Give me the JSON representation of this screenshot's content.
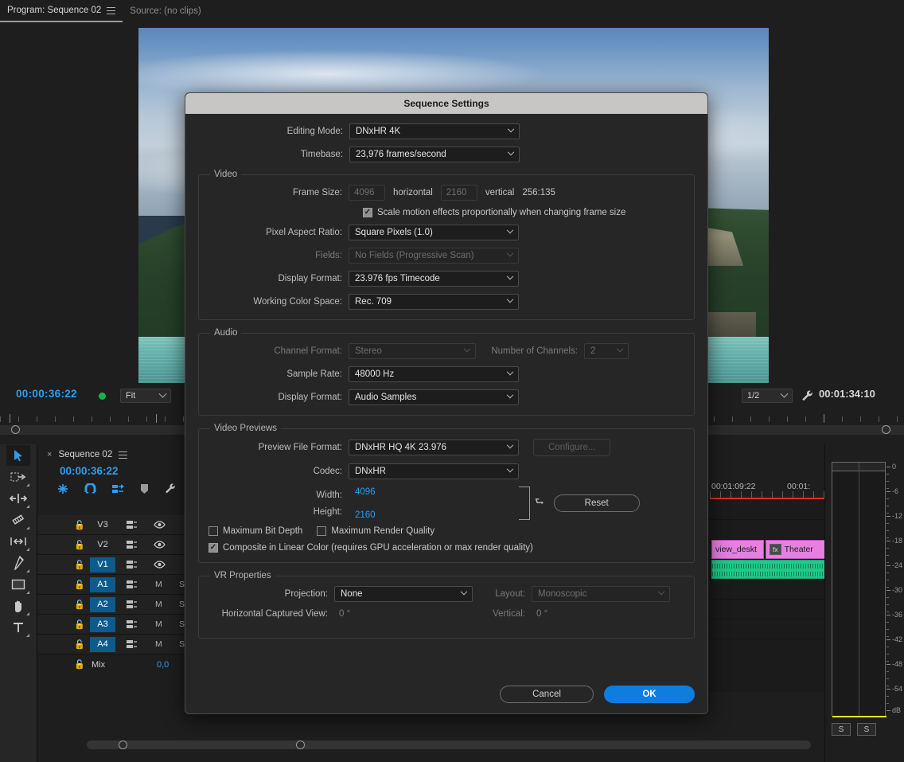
{
  "app": {
    "panel_tabs": [
      {
        "label": "Program: Sequence 02",
        "active": true,
        "menu_icon": "hamburger-menu-icon"
      },
      {
        "label": "Source: (no clips)",
        "active": false
      }
    ]
  },
  "program_monitor": {
    "current_timecode": "00:00:36:22",
    "status_dot": "green-record-dot",
    "zoom_level": "Fit",
    "playback_resolution": "1/2",
    "settings_icon": "wrench-icon",
    "duration_timecode": "00:01:34:10"
  },
  "timeline_panel": {
    "tab_label": "Sequence 02",
    "close_icon": "close-icon",
    "menu_icon": "hamburger-menu-icon",
    "playhead_timecode": "00:00:36:22",
    "toggle_icons": [
      "insert-overwrite-sequence-icon",
      "snap-magnet-icon",
      "linked-selection-icon",
      "add-marker-icon",
      "timeline-settings-wrench-icon"
    ],
    "ruler_labels": [
      "00:01:09:22",
      "00:01:"
    ],
    "tracks": [
      {
        "name": "V3",
        "type": "video",
        "targeted": false,
        "lock": "lock-icon",
        "sync": "sync-lock-icon",
        "eye": "eye-icon"
      },
      {
        "name": "V2",
        "type": "video",
        "targeted": false,
        "lock": "lock-icon",
        "sync": "sync-lock-icon",
        "eye": "eye-icon"
      },
      {
        "name": "V1",
        "type": "video",
        "targeted": true,
        "lock": "lock-icon",
        "sync": "sync-lock-icon",
        "eye": "eye-icon"
      },
      {
        "name": "A1",
        "type": "audio",
        "targeted": true,
        "lock": "lock-icon",
        "sync": "sync-lock-icon",
        "mute": "M",
        "solo": "S"
      },
      {
        "name": "A2",
        "type": "audio",
        "targeted": true,
        "lock": "lock-icon",
        "sync": "sync-lock-icon",
        "mute": "M",
        "solo": "S"
      },
      {
        "name": "A3",
        "type": "audio",
        "targeted": true,
        "lock": "lock-icon",
        "sync": "sync-lock-icon",
        "mute": "M",
        "solo": "S"
      },
      {
        "name": "A4",
        "type": "audio",
        "targeted": true,
        "lock": "lock-icon",
        "sync": "sync-lock-icon",
        "mute": "M",
        "solo": "S"
      }
    ],
    "mix_track": {
      "name": "Mix",
      "lock": "lock-icon",
      "value": "0,0"
    },
    "clips": [
      {
        "label": "view_deskt",
        "type": "video",
        "has_fx": false
      },
      {
        "label": "Theater",
        "type": "video",
        "has_fx": true,
        "fx_badge": "fx"
      }
    ],
    "add_track_button": "+"
  },
  "tools": [
    {
      "name": "selection-tool",
      "glyph": "arrow",
      "active": true
    },
    {
      "name": "track-select-forward-tool",
      "glyph": "track-select",
      "active": false
    },
    {
      "name": "ripple-edit-tool",
      "glyph": "ripple",
      "active": false
    },
    {
      "name": "razor-tool",
      "glyph": "razor",
      "active": false
    },
    {
      "name": "slip-tool",
      "glyph": "slip",
      "active": false
    },
    {
      "name": "pen-tool",
      "glyph": "pen",
      "active": false
    },
    {
      "name": "rectangle-tool",
      "glyph": "rect",
      "active": false
    },
    {
      "name": "hand-tool",
      "glyph": "hand",
      "active": false
    },
    {
      "name": "type-tool",
      "glyph": "type",
      "active": false
    }
  ],
  "audio_meters": {
    "scale_labels": [
      "0",
      "-6",
      "-12",
      "-18",
      "-24",
      "-30",
      "-36",
      "-42",
      "-48",
      "-54",
      "dB"
    ],
    "solo_buttons": [
      "S",
      "S"
    ],
    "channels": 2
  },
  "dialog": {
    "title": "Sequence Settings",
    "fields": {
      "editing_mode": {
        "label": "Editing Mode:",
        "value": "DNxHR 4K",
        "disabled": false
      },
      "timebase": {
        "label": "Timebase:",
        "value": "23,976  frames/second",
        "disabled": false
      }
    },
    "video_group": {
      "legend": "Video",
      "frame_size_label": "Frame Size:",
      "frame_width": "4096",
      "horizontal_label": "horizontal",
      "frame_height": "2160",
      "vertical_label": "vertical",
      "aspect_ratio": "256:135",
      "scale_motion_label": "Scale motion effects proportionally when changing frame size",
      "scale_motion_checked": true,
      "pixel_aspect_ratio": {
        "label": "Pixel Aspect Ratio:",
        "value": "Square Pixels (1.0)",
        "disabled": false
      },
      "fields": {
        "label": "Fields:",
        "value": "No Fields (Progressive Scan)",
        "disabled": true
      },
      "display_format": {
        "label": "Display Format:",
        "value": "23.976 fps Timecode",
        "disabled": false
      },
      "working_color_space": {
        "label": "Working Color Space:",
        "value": "Rec. 709",
        "disabled": false
      }
    },
    "audio_group": {
      "legend": "Audio",
      "channel_format": {
        "label": "Channel Format:",
        "value": "Stereo",
        "disabled": true
      },
      "number_of_channels": {
        "label": "Number of Channels:",
        "value": "2",
        "disabled": true
      },
      "sample_rate": {
        "label": "Sample Rate:",
        "value": "48000 Hz",
        "disabled": false
      },
      "display_format": {
        "label": "Display Format:",
        "value": "Audio Samples",
        "disabled": false
      }
    },
    "video_previews_group": {
      "legend": "Video Previews",
      "preview_file_format": {
        "label": "Preview File Format:",
        "value": "DNxHR HQ 4K 23.976",
        "disabled": false
      },
      "configure_button": {
        "label": "Configure...",
        "disabled": true
      },
      "codec": {
        "label": "Codec:",
        "value": "DNxHR",
        "disabled": false
      },
      "width": {
        "label": "Width:",
        "value": "4096"
      },
      "height": {
        "label": "Height:",
        "value": "2160"
      },
      "link_icon": "chain-link-icon",
      "reset_button": "Reset",
      "max_bit_depth": {
        "label": "Maximum Bit Depth",
        "checked": false
      },
      "max_render_quality": {
        "label": "Maximum Render Quality",
        "checked": false
      },
      "composite_linear": {
        "label": "Composite in Linear Color (requires GPU acceleration or max render quality)",
        "checked": true
      }
    },
    "vr_group": {
      "legend": "VR Properties",
      "projection": {
        "label": "Projection:",
        "value": "None",
        "disabled": false
      },
      "layout": {
        "label": "Layout:",
        "value": "Monoscopic",
        "disabled": true
      },
      "horizontal_captured_view": {
        "label": "Horizontal Captured View:",
        "value": "0 °"
      },
      "vertical_captured_view": {
        "label": "Vertical:",
        "value": "0 °"
      }
    },
    "buttons": {
      "cancel": "Cancel",
      "ok": "OK"
    }
  },
  "colors": {
    "accent_blue": "#2d9cf0",
    "primary_button": "#0d7ee0",
    "track_target": "#0d5a8c",
    "clip_video": "#e57fe0",
    "clip_audio": "#1fc98a",
    "render_bar_red": "#e02b2b",
    "status_green": "#18b14b",
    "dialog_titlebar": "#c8c6c4"
  }
}
